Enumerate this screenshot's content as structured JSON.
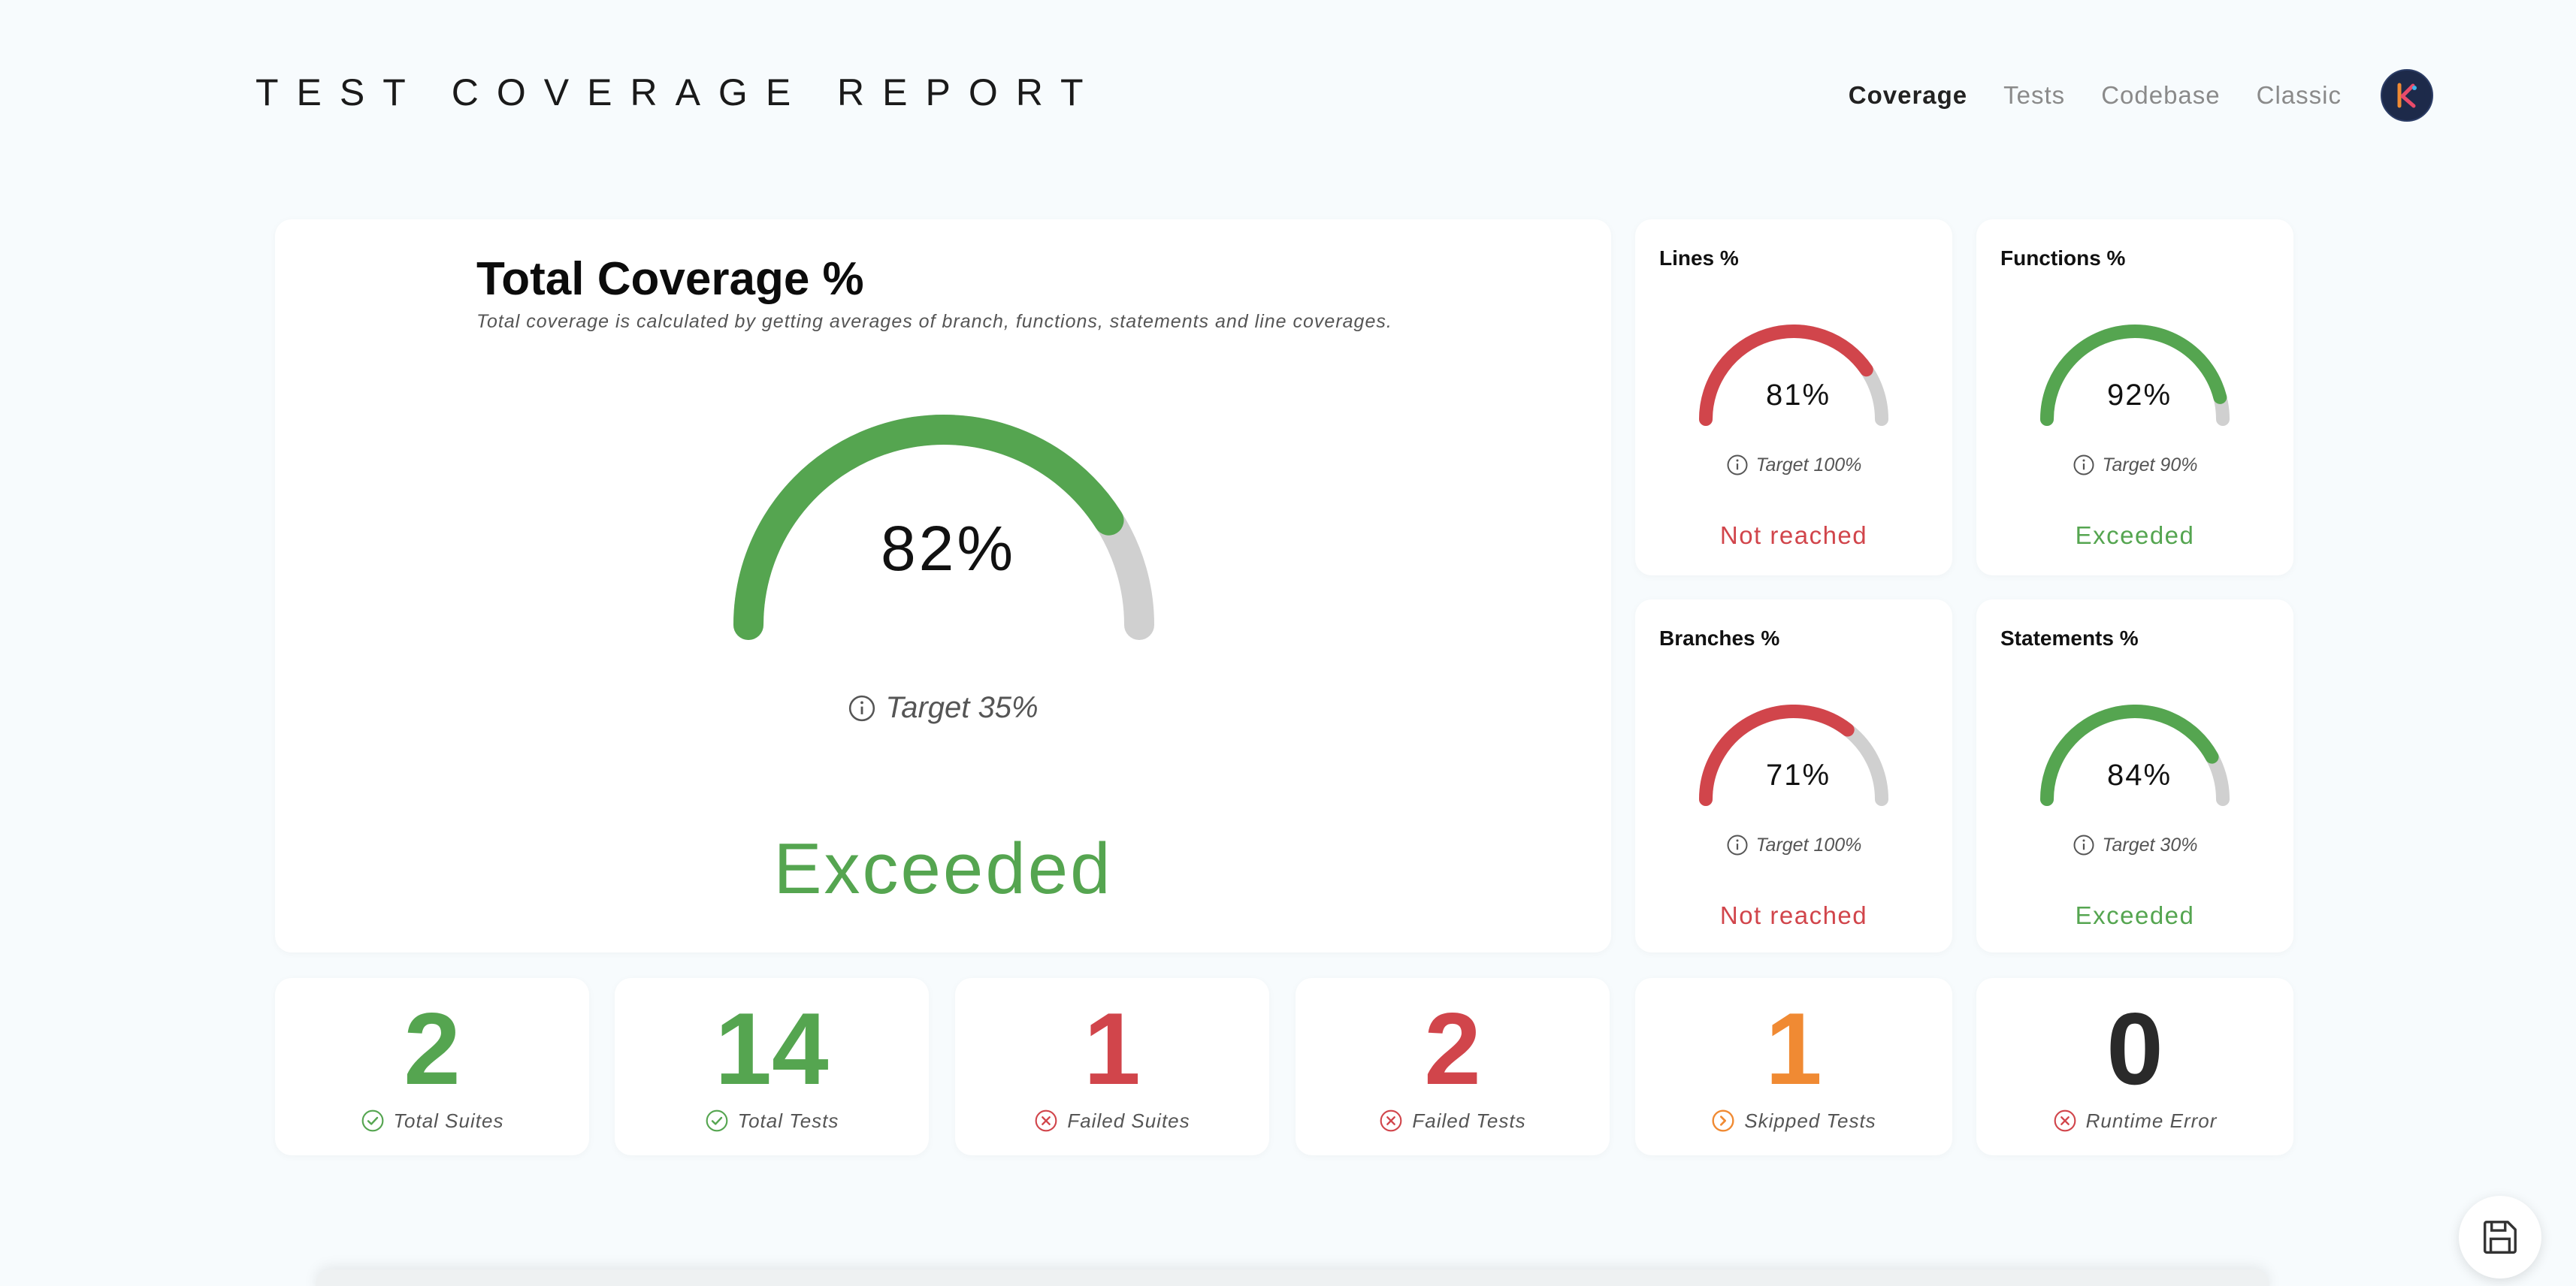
{
  "header": {
    "brand": "TEST COVERAGE REPORT",
    "nav": [
      "Coverage",
      "Tests",
      "Codebase",
      "Classic"
    ],
    "active_nav": "Coverage",
    "avatar_letter": "K"
  },
  "colors": {
    "green": "#55a550",
    "red": "#d1454b",
    "orange": "#f08a33",
    "dark": "#2a2a2a",
    "track": "#d0d0d0"
  },
  "total": {
    "title": "Total Coverage %",
    "subtitle": "Total coverage is calculated by getting averages of branch, functions, statements and line coverages.",
    "value": 82,
    "pct_text": "82%",
    "target_text": "Target 35%",
    "status": "Exceeded"
  },
  "metrics": [
    {
      "title": "Lines %",
      "value": 81,
      "pct_text": "81%",
      "target_text": "Target 100%",
      "status": "Not reached",
      "state": "fail"
    },
    {
      "title": "Functions %",
      "value": 92,
      "pct_text": "92%",
      "target_text": "Target 90%",
      "status": "Exceeded",
      "state": "pass"
    },
    {
      "title": "Branches %",
      "value": 71,
      "pct_text": "71%",
      "target_text": "Target 100%",
      "status": "Not reached",
      "state": "fail"
    },
    {
      "title": "Statements %",
      "value": 84,
      "pct_text": "84%",
      "target_text": "Target 30%",
      "status": "Exceeded",
      "state": "pass"
    }
  ],
  "stats": [
    {
      "value": "2",
      "label": "Total Suites",
      "kind": "check",
      "color": "#55a550"
    },
    {
      "value": "14",
      "label": "Total Tests",
      "kind": "check",
      "color": "#55a550"
    },
    {
      "value": "1",
      "label": "Failed Suites",
      "kind": "cross",
      "color": "#d1454b"
    },
    {
      "value": "2",
      "label": "Failed Tests",
      "kind": "cross",
      "color": "#d1454b"
    },
    {
      "value": "1",
      "label": "Skipped Tests",
      "kind": "skip",
      "color": "#f08a33"
    },
    {
      "value": "0",
      "label": "Runtime Error",
      "kind": "cross",
      "color": "#2a2a2a"
    }
  ]
}
